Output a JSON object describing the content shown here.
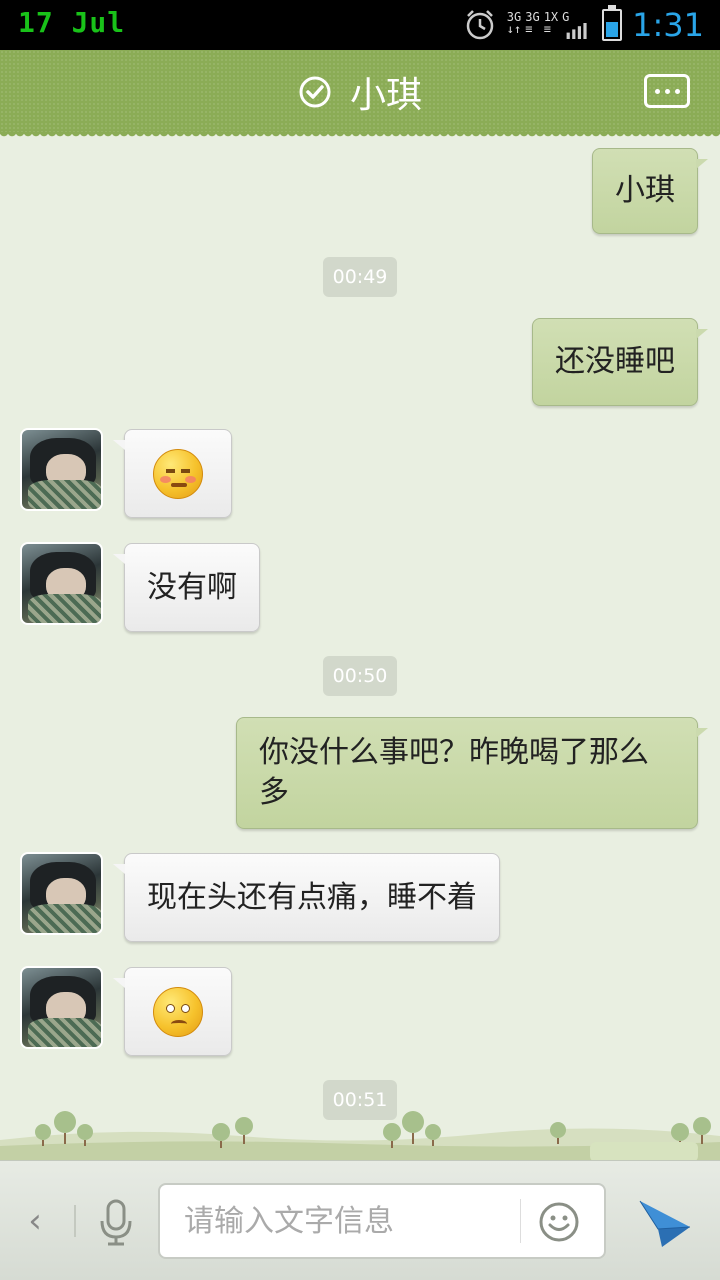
{
  "status_bar": {
    "date": "17 Jul",
    "network_labels": [
      "3G",
      "3G",
      "1X",
      "G"
    ],
    "time": "1:31",
    "battery_level": 0.55
  },
  "header": {
    "title": "小琪",
    "verified_icon": "check-circle-icon",
    "menu_icon": "more-icon"
  },
  "messages": [
    {
      "type": "outgoing",
      "text": "小琪"
    },
    {
      "type": "timestamp",
      "text": "00:49"
    },
    {
      "type": "outgoing",
      "text": "还没睡吧"
    },
    {
      "type": "incoming",
      "emoji": "sleepy-blush-emoji"
    },
    {
      "type": "incoming",
      "text": "没有啊"
    },
    {
      "type": "timestamp",
      "text": "00:50"
    },
    {
      "type": "outgoing",
      "text": "你没什么事吧？昨晚喝了那么多"
    },
    {
      "type": "incoming",
      "text": "现在头还有点痛，睡不着"
    },
    {
      "type": "incoming",
      "emoji": "sad-emoji"
    },
    {
      "type": "timestamp",
      "text": "00:51"
    }
  ],
  "input_bar": {
    "placeholder": "请输入文字信息",
    "value": "",
    "icons": [
      "back-icon",
      "microphone-icon",
      "smiley-icon",
      "send-icon"
    ]
  },
  "colors": {
    "header": "#8bac56",
    "chat_background": "#e9efe1",
    "outgoing_bubble": "#c9d9aa",
    "incoming_bubble": "#f5f5f5",
    "status_time": "#2aa5e8",
    "status_date": "#19c219"
  }
}
